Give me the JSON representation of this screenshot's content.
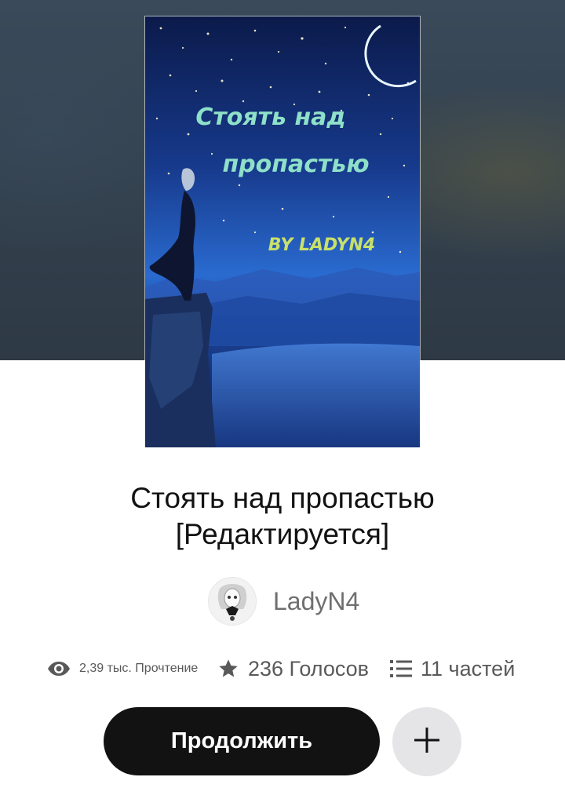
{
  "story": {
    "cover": {
      "title_line1": "Стоять над",
      "title_line2": "пропастью",
      "byline": "BY LADYN4"
    },
    "title_line1": "Стоять над пропастью",
    "title_line2": "[Редактируется]",
    "author": "LadyN4"
  },
  "stats": {
    "reads": "2,39 тыс. Прочтение",
    "votes": "236 Голосов",
    "parts": "11 частей"
  },
  "actions": {
    "continue_label": "Продолжить"
  },
  "icons": {
    "reads": "eye-icon",
    "votes": "star-icon",
    "parts": "list-icon",
    "add": "plus-icon"
  },
  "colors": {
    "header_bg": "#34424f",
    "button_dark": "#121212",
    "button_light": "#e5e5e7",
    "text_primary": "#121212",
    "text_secondary": "#595959"
  }
}
